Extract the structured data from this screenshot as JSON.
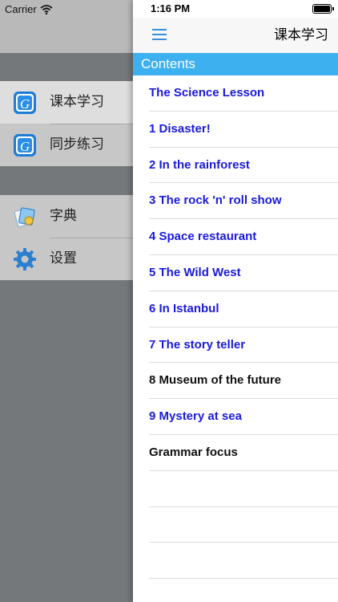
{
  "status": {
    "carrier": "Carrier",
    "time": "1:16 PM"
  },
  "menu": {
    "items": [
      {
        "label": "课本学习",
        "icon": "book-app-icon",
        "selected": true
      },
      {
        "label": "同步练习",
        "icon": "book-app-icon",
        "selected": false
      },
      {
        "label": "字典",
        "icon": "dictionary-icon",
        "selected": false
      },
      {
        "label": "设置",
        "icon": "gear-icon",
        "selected": false
      }
    ]
  },
  "nav": {
    "title": "课本学习",
    "menu_icon": "hamburger-icon"
  },
  "contents": {
    "header": "Contents",
    "items": [
      {
        "label": "The Science Lesson",
        "color": "#1a1adc"
      },
      {
        "label": "1 Disaster!",
        "color": "#1a1adc"
      },
      {
        "label": "2 In the rainforest",
        "color": "#1a1adc"
      },
      {
        "label": "3 The rock 'n' roll show",
        "color": "#1a1adc"
      },
      {
        "label": "4 Space restaurant",
        "color": "#1a1adc"
      },
      {
        "label": "5 The Wild West",
        "color": "#1a1adc"
      },
      {
        "label": "6 In Istanbul",
        "color": "#1a1adc"
      },
      {
        "label": "7 The story teller",
        "color": "#1a1adc"
      },
      {
        "label": "8 Museum of the future",
        "color": "#111111"
      },
      {
        "label": "9 Mystery at sea",
        "color": "#1a1adc"
      },
      {
        "label": "Grammar focus",
        "color": "#111111"
      }
    ]
  },
  "colors": {
    "accent": "#3db0f0",
    "link": "#1a1adc"
  }
}
